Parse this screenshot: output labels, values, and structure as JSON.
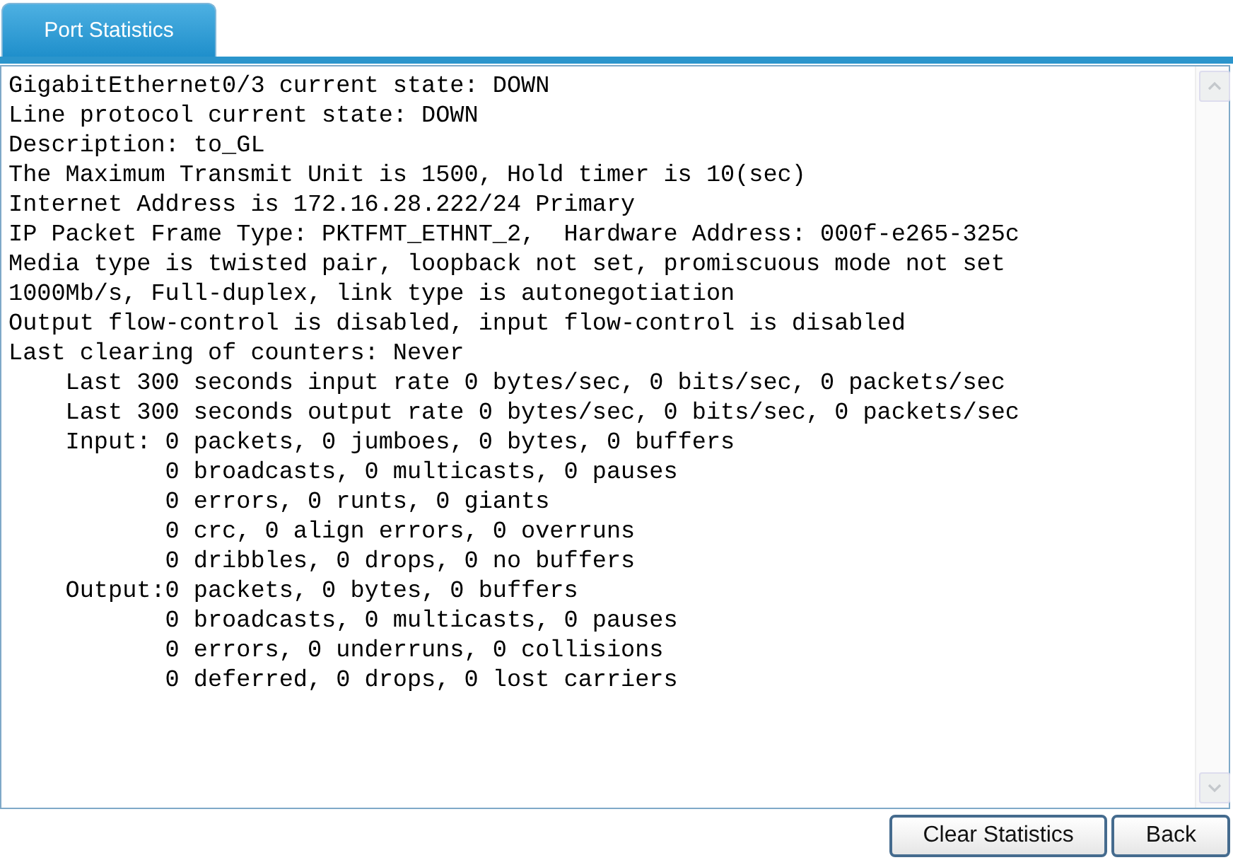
{
  "tabs": [
    {
      "label": "Port Statistics",
      "selected": true
    }
  ],
  "output_lines": [
    "GigabitEthernet0/3 current state: DOWN",
    "Line protocol current state: DOWN",
    "Description: to_GL",
    "The Maximum Transmit Unit is 1500, Hold timer is 10(sec)",
    "Internet Address is 172.16.28.222/24 Primary",
    "IP Packet Frame Type: PKTFMT_ETHNT_2,  Hardware Address: 000f-e265-325c",
    "Media type is twisted pair, loopback not set, promiscuous mode not set",
    "1000Mb/s, Full-duplex, link type is autonegotiation",
    "Output flow-control is disabled, input flow-control is disabled",
    "Last clearing of counters: Never",
    "    Last 300 seconds input rate 0 bytes/sec, 0 bits/sec, 0 packets/sec",
    "    Last 300 seconds output rate 0 bytes/sec, 0 bits/sec, 0 packets/sec",
    "    Input: 0 packets, 0 jumboes, 0 bytes, 0 buffers",
    "           0 broadcasts, 0 multicasts, 0 pauses",
    "           0 errors, 0 runts, 0 giants",
    "           0 crc, 0 align errors, 0 overruns",
    "           0 dribbles, 0 drops, 0 no buffers",
    "    Output:0 packets, 0 bytes, 0 buffers",
    "           0 broadcasts, 0 multicasts, 0 pauses",
    "           0 errors, 0 underruns, 0 collisions",
    "           0 deferred, 0 drops, 0 lost carriers"
  ],
  "buttons": [
    "Clear Statistics",
    "Back"
  ]
}
